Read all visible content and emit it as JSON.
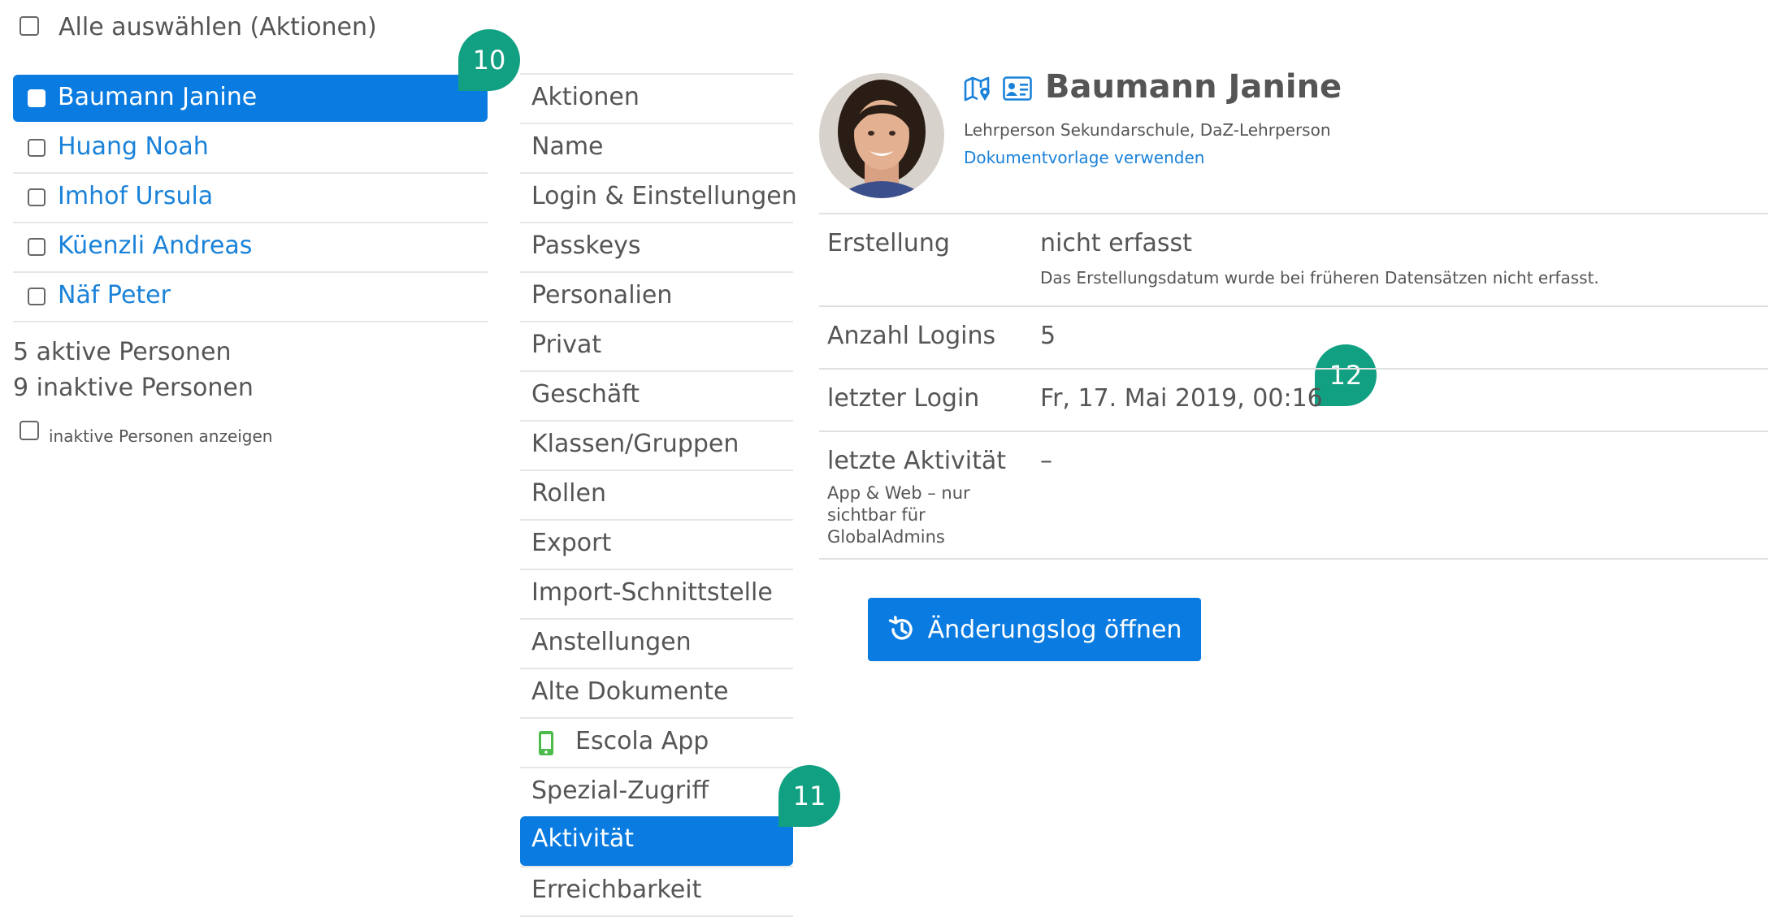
{
  "select_all_label": "Alle auswählen (Aktionen)",
  "persons": [
    {
      "name": "Baumann Janine",
      "active": true
    },
    {
      "name": "Huang Noah",
      "active": false
    },
    {
      "name": "Imhof Ursula",
      "active": false
    },
    {
      "name": "Küenzli Andreas",
      "active": false
    },
    {
      "name": "Näf Peter",
      "active": false
    }
  ],
  "active_count": "5 aktive Personen",
  "inactive_count": "9 inaktive Personen",
  "show_inactive_label": "inaktive Personen anzeigen",
  "tabs": [
    {
      "label": "Aktionen"
    },
    {
      "label": "Name"
    },
    {
      "label": "Login & Einstellungen"
    },
    {
      "label": "Passkeys"
    },
    {
      "label": "Personalien"
    },
    {
      "label": "Privat"
    },
    {
      "label": "Geschäft"
    },
    {
      "label": "Klassen/Gruppen"
    },
    {
      "label": "Rollen"
    },
    {
      "label": "Export"
    },
    {
      "label": "Import-Schnittstelle"
    },
    {
      "label": "Anstellungen"
    },
    {
      "label": "Alte Dokumente"
    },
    {
      "label": "Escola App",
      "icon": "phone-icon"
    },
    {
      "label": "Spezial-Zugriff"
    },
    {
      "label": "Aktivität",
      "active": true
    },
    {
      "label": "Erreichbarkeit"
    }
  ],
  "badges": {
    "b1": "10",
    "b2": "11",
    "b3": "12"
  },
  "profile": {
    "name": "Baumann Janine",
    "role": "Lehrperson Sekundarschule, DaZ-Lehrperson",
    "doc_link": "Dokumentvorlage verwenden"
  },
  "info": {
    "creation": {
      "key": "Erstellung",
      "value": "nicht erfasst",
      "note": "Das Erstellungsdatum wurde bei früheren Datensätzen nicht erfasst."
    },
    "logins": {
      "key": "Anzahl Logins",
      "value": "5"
    },
    "last_login": {
      "key": "letzter Login",
      "value": "Fr, 17. Mai 2019, 00:16"
    },
    "last_activity": {
      "key": "letzte Aktivität",
      "sub": "App & Web – nur sichtbar für GlobalAdmins",
      "value": "–"
    }
  },
  "changelog_button": "Änderungslog öffnen",
  "colors": {
    "accent": "#0a7be0",
    "link": "#1a82d9",
    "badge": "#12a083",
    "phone_icon": "#4cbb4c"
  }
}
